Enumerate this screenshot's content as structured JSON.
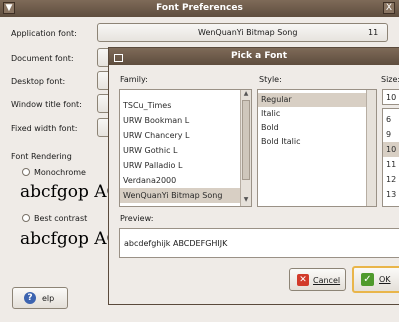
{
  "window": {
    "title": "Font Preferences",
    "close_glyph": "X",
    "menu_glyph": "▼"
  },
  "fonts": {
    "application_label": "Application font:",
    "application_value": "WenQuanYi Bitmap Song",
    "application_size": "11",
    "document_label": "Document font:",
    "desktop_label": "Desktop font:",
    "window_title_label": "Window title font:",
    "fixed_width_label": "Fixed width font:"
  },
  "rendering": {
    "header": "Font Rendering",
    "monochrome_label": "Monochrome",
    "best_contrast_label": "Best contrast",
    "sample_text": "abcfgop AO"
  },
  "help_button": {
    "label": "elp"
  },
  "dialog": {
    "title": "Pick a Font",
    "family_header": "Family:",
    "style_header": "Style:",
    "size_header": "Size:",
    "families": [
      "TSCu_Times",
      "URW Bookman L",
      "URW Chancery L",
      "URW Gothic L",
      "URW Palladio L",
      "Verdana2000",
      "WenQuanYi Bitmap Song"
    ],
    "selected_family_index": 6,
    "styles": [
      "Regular",
      "Italic",
      "Bold",
      "Bold Italic"
    ],
    "selected_style_index": 0,
    "size_value": "10",
    "sizes": [
      "6",
      "9",
      "10",
      "11",
      "12",
      "13"
    ],
    "selected_size_index": 2,
    "preview_header": "Preview:",
    "preview_text": "abcdefghijk ABCDEFGHIJK",
    "cancel_label": "Cancel",
    "ok_label": "OK"
  },
  "colors": {
    "titlebar": "#6e5a48",
    "selection": "#d8cfc4",
    "ok_accent": "#e9b54a"
  }
}
